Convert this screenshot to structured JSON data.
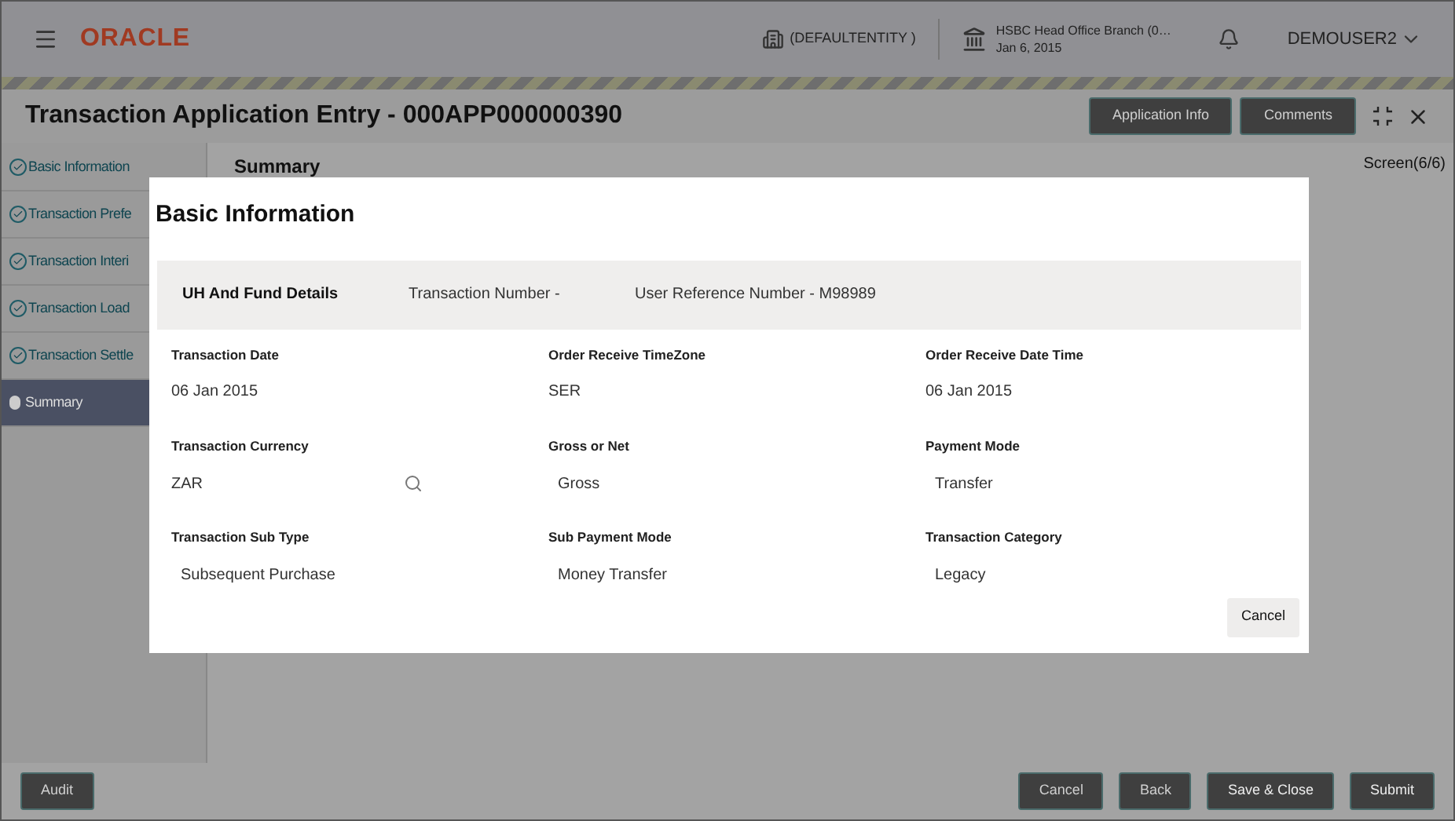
{
  "header": {
    "brand": "ORACLE",
    "entity": "(DEFAULTENTITY )",
    "branch": "HSBC Head Office Branch (0…",
    "branch_date": "Jan 6, 2015",
    "user": "DEMOUSER2"
  },
  "page": {
    "title": "Transaction Application Entry - 000APP000000390",
    "actions": [
      "Application Info",
      "Comments"
    ]
  },
  "steps": [
    {
      "label": "Basic Information",
      "selected": false
    },
    {
      "label": "Transaction Prefe",
      "selected": false
    },
    {
      "label": "Transaction Interi",
      "selected": false
    },
    {
      "label": "Transaction Load",
      "selected": false
    },
    {
      "label": "Transaction Settle",
      "selected": false
    },
    {
      "label": "Summary",
      "selected": true
    }
  ],
  "content": {
    "heading": "Summary",
    "screen": "Screen(6/6)"
  },
  "dialog": {
    "title": "Basic Information",
    "band": {
      "heading": "UH And Fund Details",
      "items": [
        "Transaction Number -",
        "User Reference Number - M98989"
      ]
    },
    "fields": [
      {
        "label": "Transaction Date",
        "value": "06 Jan 2015",
        "kind": "text"
      },
      {
        "label": "Order Receive TimeZone",
        "value": "SER",
        "kind": "text"
      },
      {
        "label": "Order Receive Date Time",
        "value": "06 Jan 2015",
        "kind": "text"
      },
      {
        "label": "Transaction Currency",
        "value": "ZAR",
        "kind": "lookup"
      },
      {
        "label": "Gross or Net",
        "value": "Gross",
        "kind": "select"
      },
      {
        "label": "Payment Mode",
        "value": "Transfer",
        "kind": "select"
      },
      {
        "label": "Transaction Sub Type",
        "value": "Subsequent Purchase",
        "kind": "select"
      },
      {
        "label": "Sub Payment Mode",
        "value": "Money Transfer",
        "kind": "select"
      },
      {
        "label": "Transaction Category",
        "value": "Legacy",
        "kind": "select"
      }
    ],
    "button": "Cancel"
  },
  "footer": {
    "left": "Audit",
    "right": [
      "Cancel",
      "Back",
      "Save & Close",
      "Submit"
    ]
  }
}
